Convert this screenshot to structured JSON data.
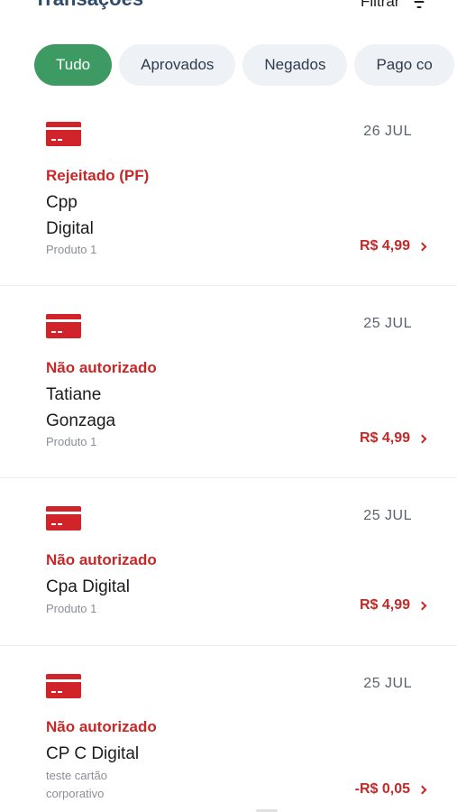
{
  "header": {
    "title": "Transações",
    "filter_label": "Filtrar",
    "filter_icon": "filter-icon"
  },
  "filters": {
    "chips": [
      {
        "label": "Tudo",
        "active": true
      },
      {
        "label": "Aprovados",
        "active": false
      },
      {
        "label": "Negados",
        "active": false
      },
      {
        "label": "Pago co",
        "active": false
      }
    ]
  },
  "transactions": [
    {
      "icon": "credit-card-icon",
      "date": "26 JUL",
      "status": "Rejeitado (PF)",
      "name_line1": "Cpp",
      "name_line2": "Digital",
      "product_line1": "Produto 1",
      "product_line2": "",
      "amount": "R$ 4,99"
    },
    {
      "icon": "credit-card-icon",
      "date": "25 JUL",
      "status": "Não autorizado",
      "name_line1": "Tatiane",
      "name_line2": "Gonzaga",
      "product_line1": "Produto 1",
      "product_line2": "",
      "amount": "R$ 4,99"
    },
    {
      "icon": "credit-card-icon",
      "date": "25 JUL",
      "status": "Não autorizado",
      "name_line1": "Cpa Digital",
      "name_line2": "",
      "product_line1": "Produto 1",
      "product_line2": "",
      "amount": "R$ 4,99"
    },
    {
      "icon": "credit-card-icon",
      "date": "25 JUL",
      "status": "Não autorizado",
      "name_line1": "CP C Digital",
      "name_line2": "",
      "product_line1": "teste cartão",
      "product_line2": "corporativo",
      "amount": "-R$ 0,05"
    }
  ],
  "colors": {
    "accent_green": "#3d9a63",
    "status_red": "#c62828",
    "card_red": "#d1232a",
    "title_blue": "#2d4b6b"
  }
}
